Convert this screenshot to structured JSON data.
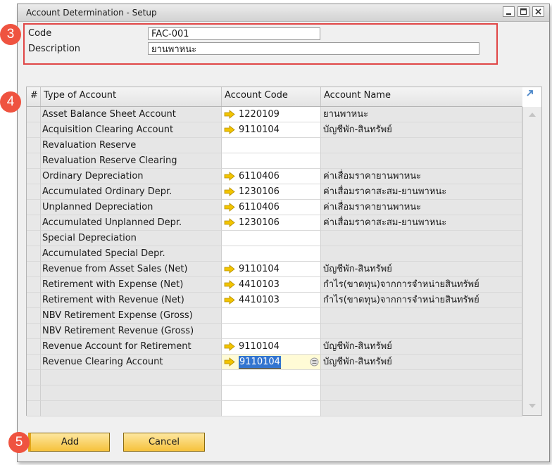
{
  "window": {
    "title": "Account Determination - Setup"
  },
  "callouts": [
    "3",
    "4",
    "5"
  ],
  "header": {
    "code_label": "Code",
    "code_value": "FAC-001",
    "description_label": "Description",
    "description_value": "ยานพาหนะ"
  },
  "grid": {
    "columns": [
      "#",
      "Type of Account",
      "Account Code",
      "Account Name"
    ],
    "rows": [
      {
        "type": "Asset Balance Sheet Account",
        "code": "1220109",
        "name": "ยานพาหนะ"
      },
      {
        "type": "Acquisition Clearing Account",
        "code": "9110104",
        "name": "บัญชีพัก-สินทรัพย์"
      },
      {
        "type": "Revaluation Reserve",
        "code": "",
        "name": ""
      },
      {
        "type": "Revaluation Reserve Clearing",
        "code": "",
        "name": ""
      },
      {
        "type": "Ordinary Depreciation",
        "code": "6110406",
        "name": "ค่าเสื่อมราคายานพาหนะ"
      },
      {
        "type": "Accumulated Ordinary Depr.",
        "code": "1230106",
        "name": "ค่าเสื่อมราคาสะสม-ยานพาหนะ"
      },
      {
        "type": "Unplanned Depreciation",
        "code": "6110406",
        "name": "ค่าเสื่อมราคายานพาหนะ"
      },
      {
        "type": "Accumulated Unplanned Depr.",
        "code": "1230106",
        "name": "ค่าเสื่อมราคาสะสม-ยานพาหนะ"
      },
      {
        "type": "Special Depreciation",
        "code": "",
        "name": ""
      },
      {
        "type": "Accumulated Special Depr.",
        "code": "",
        "name": ""
      },
      {
        "type": "Revenue from Asset Sales (Net)",
        "code": "9110104",
        "name": "บัญชีพัก-สินทรัพย์"
      },
      {
        "type": "Retirement with Expense (Net)",
        "code": "4410103",
        "name": "กำไร(ขาดทุน)จากการจำหน่ายสินทรัพย์"
      },
      {
        "type": "Retirement with Revenue (Net)",
        "code": "4410103",
        "name": "กำไร(ขาดทุน)จากการจำหน่ายสินทรัพย์"
      },
      {
        "type": "NBV Retirement Expense (Gross)",
        "code": "",
        "name": ""
      },
      {
        "type": "NBV Retirement Revenue (Gross)",
        "code": "",
        "name": ""
      },
      {
        "type": "Revenue Account for Retirement",
        "code": "9110104",
        "name": "บัญชีพัก-สินทรัพย์"
      },
      {
        "type": "Revenue Clearing Account",
        "code": "9110104",
        "name": "บัญชีพัก-สินทรัพย์",
        "active": true
      }
    ],
    "empty_rows": 3
  },
  "buttons": {
    "add": "Add",
    "cancel": "Cancel"
  },
  "colors": {
    "callout": "#ef5340",
    "highlight_border": "#e04646",
    "button": "#f6c23c",
    "selection": "#3275d0",
    "link_arrow": "#f2c400"
  }
}
